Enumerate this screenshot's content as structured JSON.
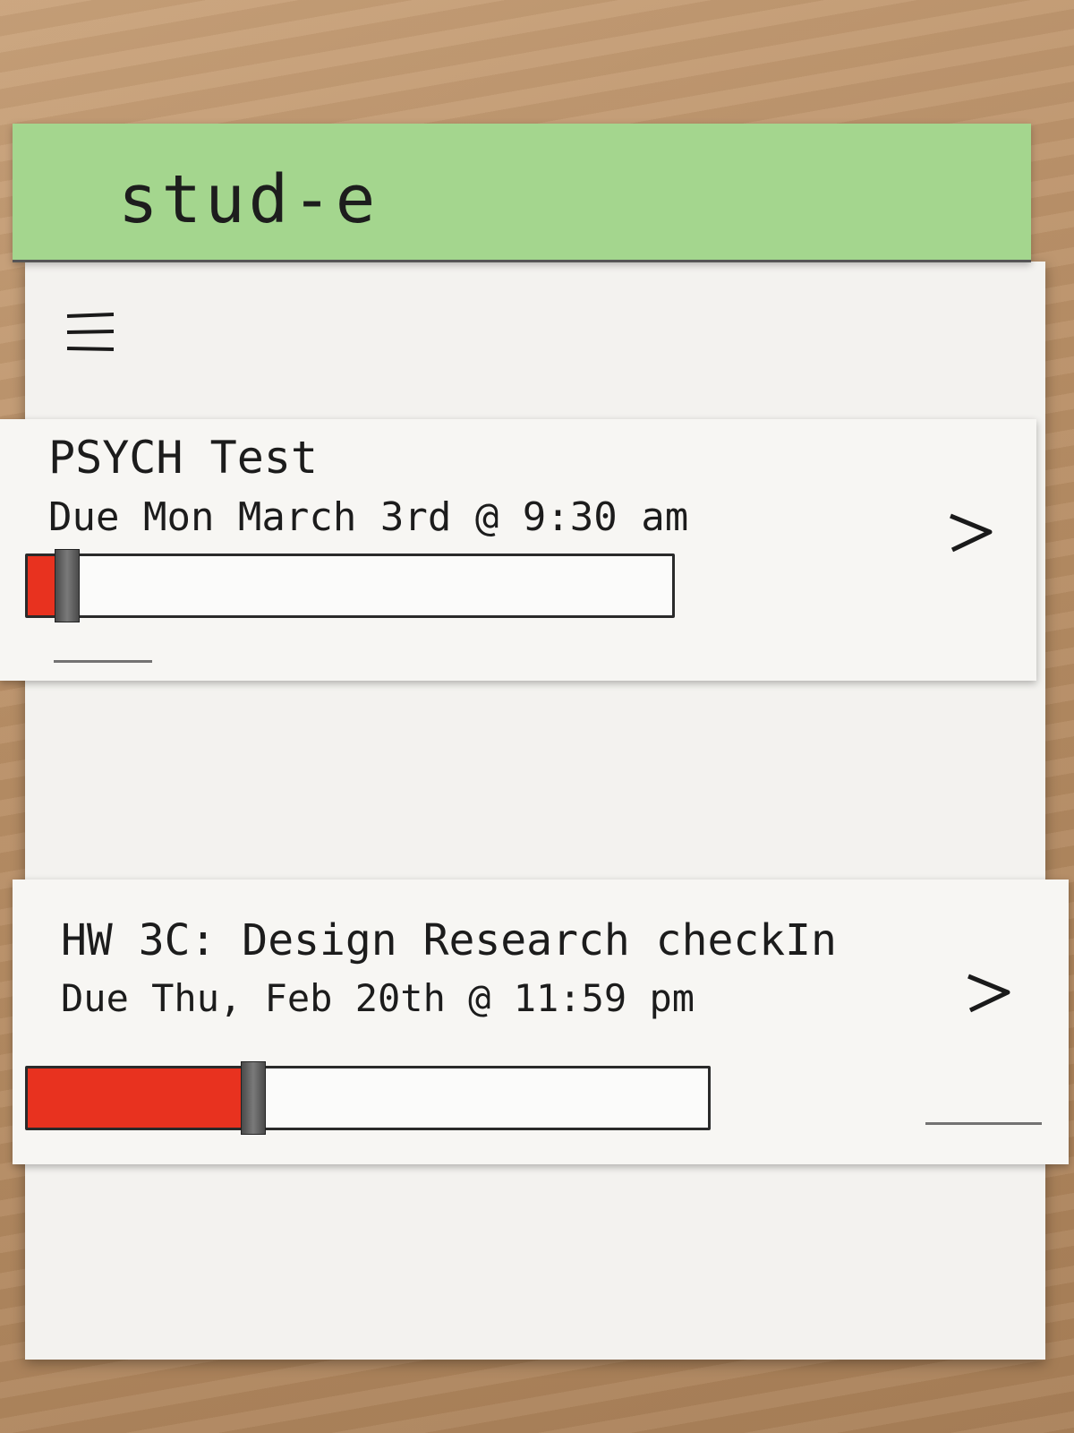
{
  "app": {
    "title": "stud-e"
  },
  "menu": {
    "icon": "hamburger-menu-icon"
  },
  "assignments": [
    {
      "title": "PSYCH Test",
      "due": "Due Mon March 3rd @ 9:30 am",
      "progress": 0.06,
      "chevron_icon": "chevron-right-icon"
    },
    {
      "title": "HW 3C: Design Research checkIn",
      "due": "Due Thu, Feb 20th @ 11:59 pm",
      "progress": 0.33,
      "chevron_icon": "chevron-right-icon"
    }
  ],
  "colors": {
    "app_bar": "#a4d68e",
    "progress_fill": "#e8321f"
  }
}
